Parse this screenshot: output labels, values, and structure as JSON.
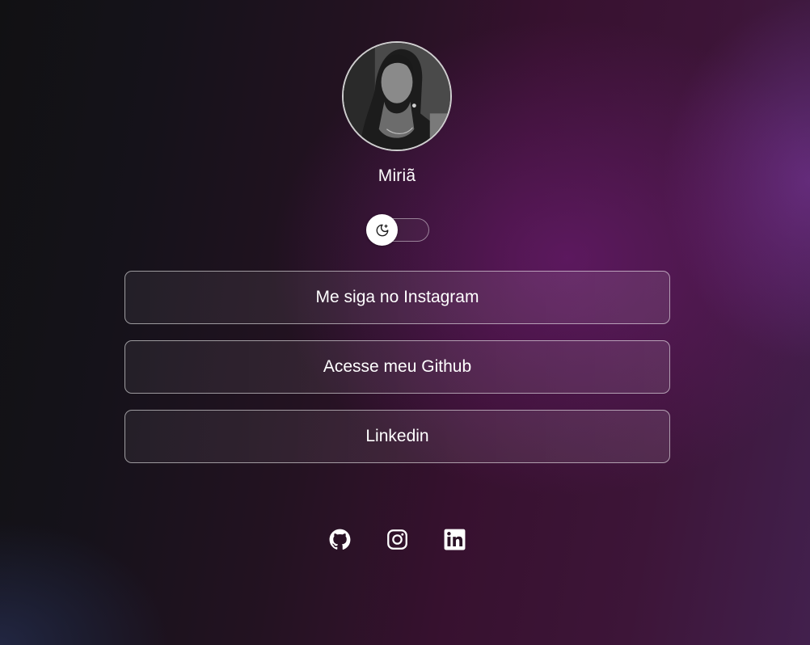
{
  "profile": {
    "name": "Miriã",
    "avatar_icon": "profile-photo"
  },
  "theme_toggle": {
    "icon": "moon-stars-icon",
    "state": "dark"
  },
  "links": [
    {
      "label": "Me siga no Instagram"
    },
    {
      "label": "Acesse meu Github"
    },
    {
      "label": "Linkedin"
    }
  ],
  "socials": [
    {
      "icon": "github-icon"
    },
    {
      "icon": "instagram-icon"
    },
    {
      "icon": "linkedin-icon"
    }
  ],
  "colors": {
    "background_dark": "#111113",
    "background_accent": "#3d1538",
    "text": "#ffffff"
  }
}
